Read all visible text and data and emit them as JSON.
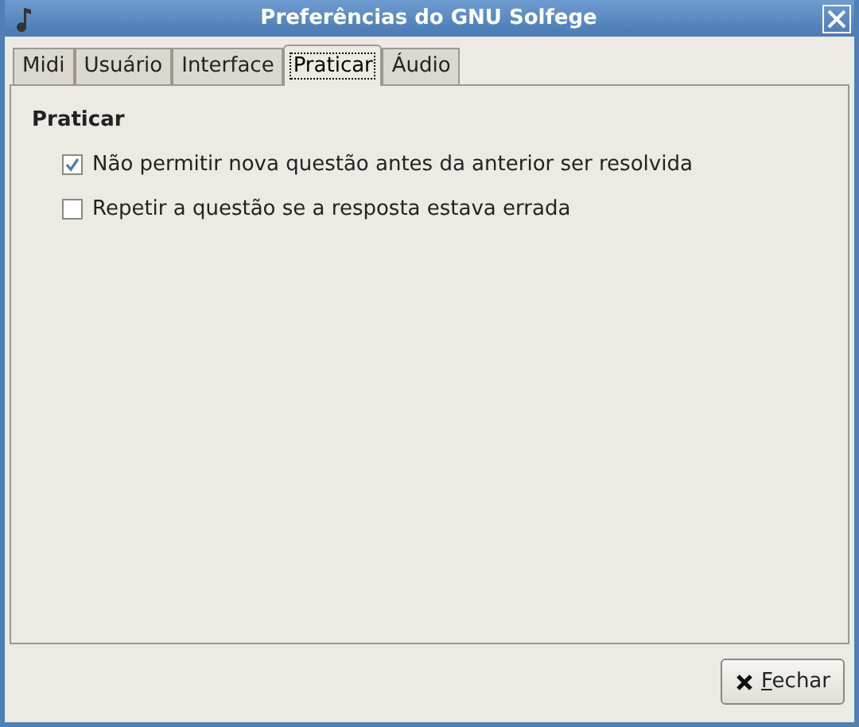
{
  "window": {
    "title": "Preferências do GNU Solfege"
  },
  "tabs": [
    {
      "label": "Midi",
      "selected": false
    },
    {
      "label": "Usuário",
      "selected": false
    },
    {
      "label": "Interface",
      "selected": false
    },
    {
      "label": "Praticar",
      "selected": true
    },
    {
      "label": "Áudio",
      "selected": false
    }
  ],
  "section": {
    "title": "Praticar",
    "options": [
      {
        "label": "Não permitir nova questão antes da anterior ser resolvida",
        "checked": true
      },
      {
        "label": "Repetir a questão se a resposta estava errada",
        "checked": false
      }
    ]
  },
  "buttons": [
    {
      "label": "Fechar",
      "mnemonic": true
    }
  ]
}
